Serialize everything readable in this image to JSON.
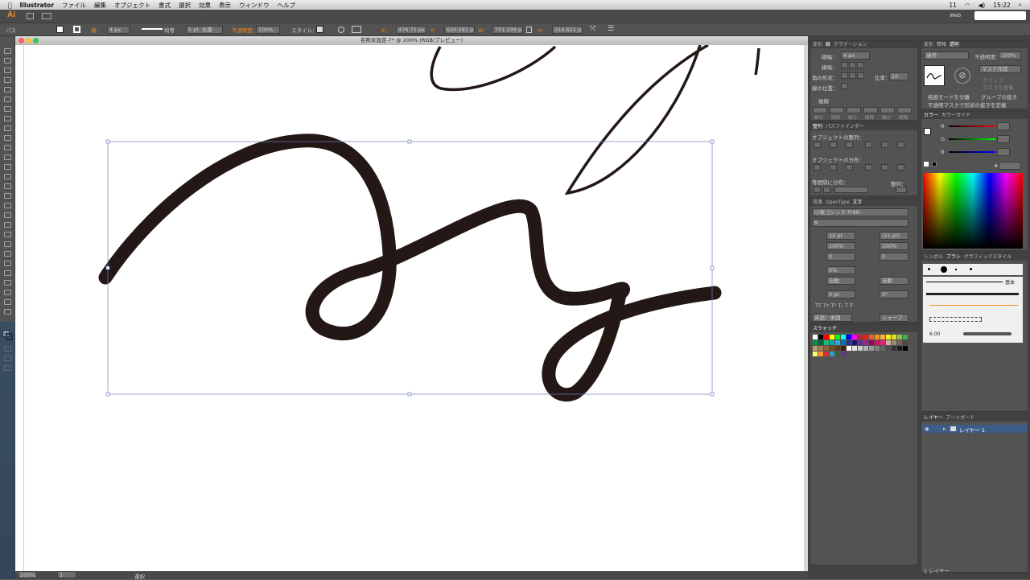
{
  "menu": {
    "apple": "",
    "app": "Illustrator",
    "items": [
      "ファイル",
      "編集",
      "オブジェクト",
      "書式",
      "選択",
      "効果",
      "表示",
      "ウィンドウ",
      "ヘルプ"
    ],
    "status_percent": "11",
    "clock": "15:22",
    "workspace": "Web"
  },
  "app_logo": "Ai",
  "control": {
    "object_type": "パス",
    "stroke_label": "線：",
    "stroke_weight": "4 px",
    "stroke_profile": "均等",
    "brush": "5 pt. 丸筆",
    "opacity_label": "不透明度：",
    "opacity": "100%",
    "style_label": "スタイル：",
    "x_label": "X：",
    "x": "476.71 px",
    "y_label": "Y：",
    "y": "620.581 px",
    "w_label": "W：",
    "w": "751.239 px",
    "h_label": "H：",
    "h": "314.621 px"
  },
  "document": {
    "title": "名称未設定-7* @ 200% (RGB/プレビュー)"
  },
  "status": {
    "zoom": "200%",
    "page": "1",
    "mode": "選択"
  },
  "stroke_panel": {
    "tabs": [
      "線",
      "変形",
      "線",
      "グラデーション"
    ],
    "weight_label": "線幅：",
    "weight": "4 px",
    "cap_label": "線端：",
    "corner_label": "角の形状：",
    "limit_label": "比率：",
    "limit": "10",
    "align_label": "線の位置：",
    "dashed_label": "破線",
    "dash_labels": [
      "線分",
      "間隔",
      "線分",
      "間隔",
      "線分",
      "間隔"
    ]
  },
  "transparency_panel": {
    "tabs": [
      "変形",
      "情報",
      "透明"
    ],
    "mode": "通常",
    "opacity_label": "不透明度：",
    "opacity": "100%",
    "mask_button": "マスク作成",
    "clip": "クリップ",
    "invert": "マスクを反転",
    "isolate": "描画モードを分離",
    "knockout": "グループの抜き",
    "opacity_mask": "不透明マスクで形状の抜きを定義"
  },
  "align_panel": {
    "tabs": [
      "整列",
      "パスファインダー"
    ],
    "align_objects": "オブジェクトの整列：",
    "distribute_objects": "オブジェクトの分布：",
    "distribute_spacing": "等間隔に分布：",
    "align_to": "整列："
  },
  "color_panel": {
    "tabs": [
      "カラー",
      "カラーガイド"
    ],
    "r": "R",
    "g": "G",
    "b": "B",
    "hex_label": "#"
  },
  "character_panel": {
    "tabs": [
      "段落",
      "OpenType",
      "文字"
    ],
    "font": "小塚ゴシック Pr6N",
    "style": "R",
    "size": "12 pt",
    "leading": "(21 pt)",
    "vscale": "100%",
    "hscale": "100%",
    "kerning": "0",
    "tracking": "0",
    "tsume": "0%",
    "aki_left": "自動",
    "aki_right": "自動",
    "baseline": "0 pt",
    "rotation": "0°",
    "language": "英語：米国",
    "aa": "シャープ"
  },
  "swatches_panel": {
    "tabs": [
      "スウォッチ"
    ],
    "colors": [
      "#ffffff",
      "#000000",
      "#ff0000",
      "#ffff00",
      "#00ff00",
      "#00ffff",
      "#0000ff",
      "#ff00ff",
      "#c1272d",
      "#ed1c24",
      "#f15a24",
      "#f7931e",
      "#fbb03b",
      "#fcee21",
      "#d9e021",
      "#8cc63f",
      "#39b54a",
      "#009245",
      "#006837",
      "#22b573",
      "#00a99d",
      "#29abe2",
      "#0071bc",
      "#2e3192",
      "#1b1464",
      "#662d91",
      "#93278f",
      "#9e005d",
      "#d4145a",
      "#ed1e79",
      "#c7b299",
      "#998675",
      "#736357",
      "#534741",
      "#c69c6d",
      "#a67c52",
      "#8c6239",
      "#754c24",
      "#603813",
      "#42210b",
      "#ffffff",
      "#e6e6e6",
      "#cccccc",
      "#b3b3b3",
      "#999999",
      "#808080",
      "#666666",
      "#4d4d4d",
      "#333333",
      "#1a1a1a",
      "#000000",
      "#ffff66",
      "#ff9933",
      "#cc3333",
      "#3399cc",
      "#336633",
      "#663399"
    ]
  },
  "brushes_panel": {
    "tabs": [
      "シンボル",
      "ブラシ",
      "グラフィックスタイル"
    ],
    "basic": "基本",
    "size": "6.00"
  },
  "layers_panel": {
    "tabs": [
      "レイヤー",
      "アートボード"
    ],
    "layer_name": "レイヤー 1",
    "count": "1 レイヤー"
  }
}
